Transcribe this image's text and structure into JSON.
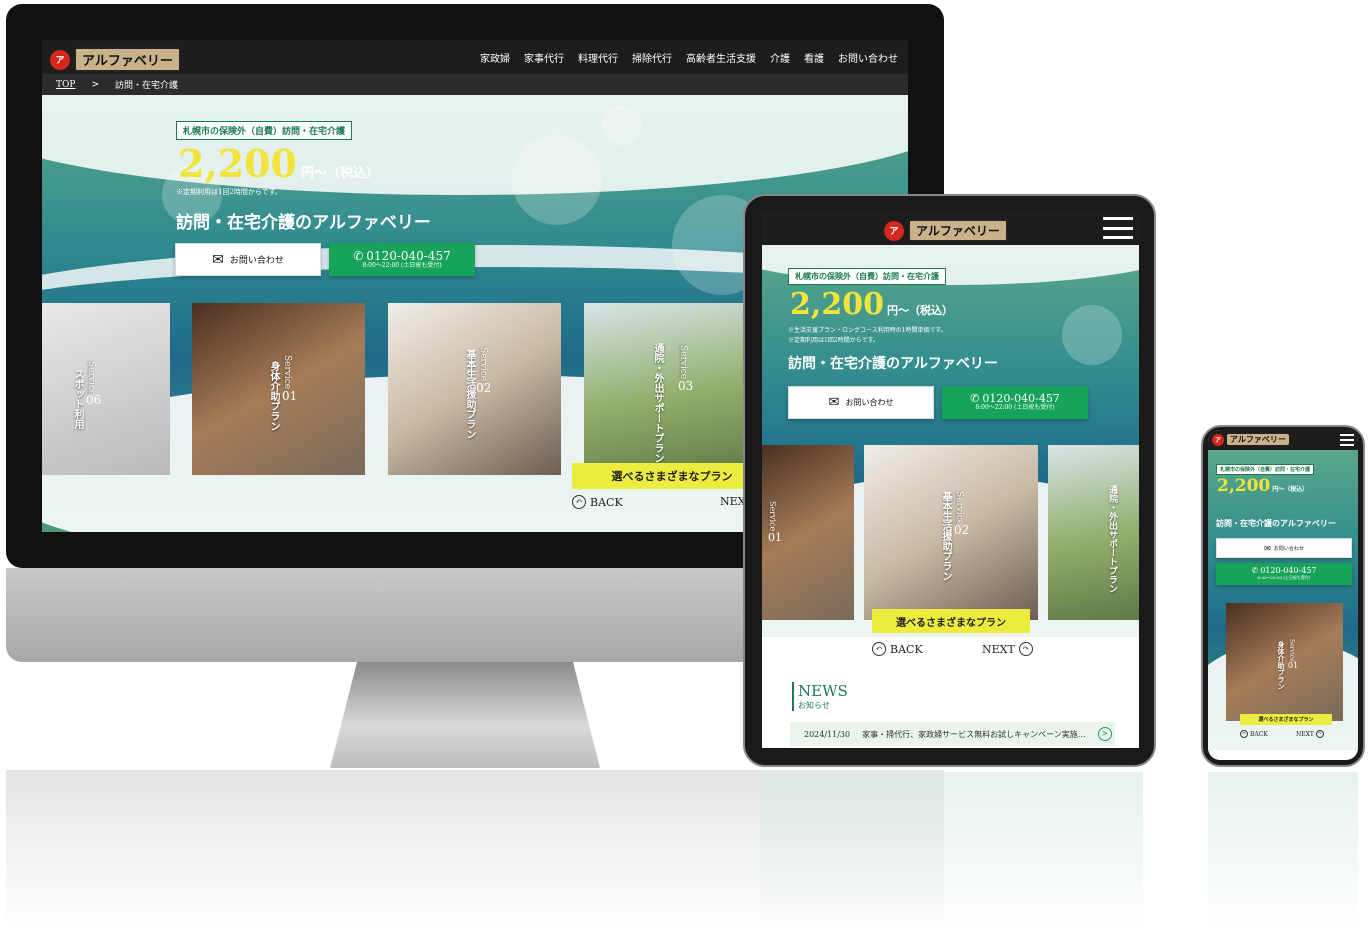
{
  "brand": {
    "logo_mark": "ア",
    "logo_text": "アルファベリー"
  },
  "desktop": {
    "nav": [
      "家政婦",
      "家事代行",
      "料理代行",
      "掃除代行",
      "高齢者生活支援",
      "介護",
      "看護",
      "お問い合わせ"
    ],
    "breadcrumb": {
      "home": "TOP",
      "separator": ">",
      "current": "訪問・在宅介護"
    },
    "hero": {
      "badge": "札幌市の保険外（自費）訪問・在宅介護",
      "price": "2,200",
      "price_unit": "円〜（税込）",
      "note": "※定期利用は1回2時間からです。",
      "title": "訪問・在宅介護のアルファベリー",
      "contact_label": "お問い合わせ",
      "phone": "0120-040-457",
      "phone_hours": "8:00〜22:00 (土日祝も受付)"
    },
    "cards": [
      {
        "label": "スポット利用",
        "service": "Service",
        "num": "06"
      },
      {
        "label": "身体介助プラン",
        "service": "Service",
        "num": "01"
      },
      {
        "label": "基本生活援助プラン",
        "service": "Service",
        "num": "02"
      },
      {
        "label": "通院・外出サポートプラン",
        "service": "Service",
        "num": "03"
      }
    ],
    "plan_banner": "選べるさまざまなプラン",
    "back": "BACK",
    "next": "NEXT"
  },
  "tablet": {
    "hero": {
      "badge": "札幌市の保険外（自費）訪問・在宅介護",
      "price": "2,200",
      "price_unit": "円〜（税込）",
      "note1": "※生活支援プラン・ロングコース利用時の1時間単価です。",
      "note2": "※定期利用は1回2時間からです。",
      "title": "訪問・在宅介護のアルファベリー",
      "contact_label": "お問い合わせ",
      "phone": "0120-040-457",
      "phone_hours": "8:00〜22:00 (土日祝も受付)"
    },
    "cards": [
      {
        "label": "Service",
        "num": "01"
      },
      {
        "label": "基本生活援助プラン",
        "service": "Service",
        "num": "02"
      },
      {
        "label": "通院・外出サポートプラン"
      }
    ],
    "plan_banner": "選べるさまざまなプラン",
    "back": "BACK",
    "next": "NEXT",
    "news": {
      "title": "NEWS",
      "subtitle": "お知らせ",
      "date": "2024/11/30",
      "text": "家事・掃代行、家政婦サービス無料お試しキャンペーン実施…"
    }
  },
  "phone": {
    "hero": {
      "badge": "札幌市の保険外（自費）訪問・在宅介護",
      "price": "2,200",
      "price_unit": "円〜（税込）",
      "title": "訪問・在宅介護のアルファベリー",
      "contact_label": "お問い合わせ",
      "phone": "0120-040-457",
      "phone_hours": "8:00〜22:00 (土日祝も受付)"
    },
    "card": {
      "label": "身体介助プラン",
      "service": "Service",
      "num": "01"
    },
    "plan_banner": "選べるさまざまなプラン",
    "back": "BACK",
    "next": "NEXT"
  }
}
